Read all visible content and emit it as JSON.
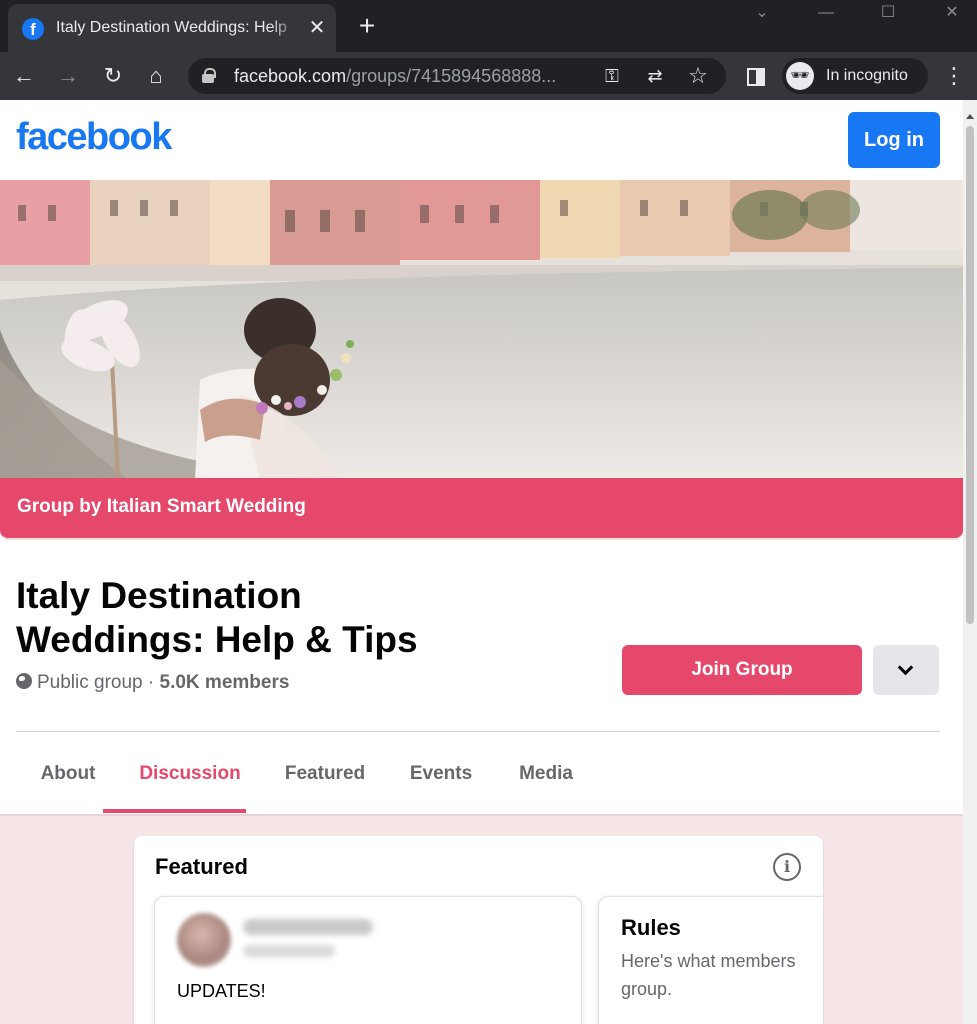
{
  "browser": {
    "tab_title": "Italy Destination Weddings: Help",
    "tab_favicon": "f",
    "close_tab_glyph": "✕",
    "new_tab_glyph": "+",
    "url_host": "facebook.com",
    "url_path": "/groups/7415894568888...",
    "incognito_label": "In incognito",
    "icons": [
      "back-icon",
      "forward-icon",
      "reload-icon",
      "home-icon",
      "lock-icon",
      "key-icon",
      "translate-icon",
      "star-icon",
      "side-panel-icon",
      "incognito-icon",
      "menu-icon"
    ]
  },
  "header": {
    "logo": "facebook",
    "login_label": "Log in",
    "brand_color": "#1877f2"
  },
  "cover": {
    "banner_text": "Group by Italian Smart Wedding",
    "accent_color": "#e5486b"
  },
  "group": {
    "title": "Italy Destination Weddings: Help & Tips",
    "privacy": "Public group",
    "separator": " · ",
    "members": "5.0K members",
    "join_label": "Join Group"
  },
  "tabs": [
    {
      "label": "About",
      "active": false
    },
    {
      "label": "Discussion",
      "active": true
    },
    {
      "label": "Featured",
      "active": false
    },
    {
      "label": "Events",
      "active": false
    },
    {
      "label": "Media",
      "active": false
    }
  ],
  "featured": {
    "heading": "Featured",
    "info_glyph": "i",
    "post": {
      "text": "UPDATES!"
    },
    "rules": {
      "title": "Rules",
      "description": "Here's what members group."
    }
  }
}
